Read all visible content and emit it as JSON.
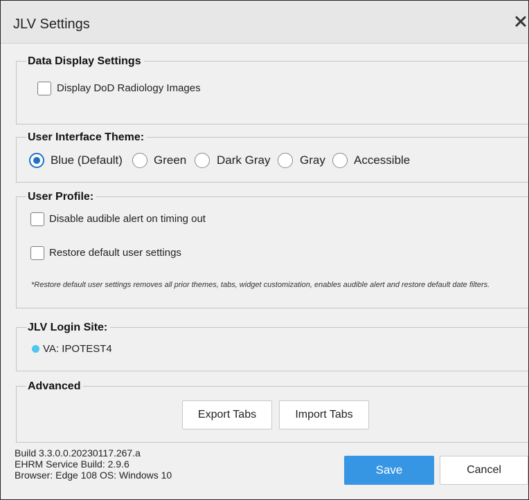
{
  "dialog": {
    "title": "JLV Settings",
    "close_icon": "close-icon"
  },
  "data_display": {
    "legend": "Data Display Settings",
    "radiology_label": "Display DoD Radiology Images",
    "radiology_checked": false
  },
  "theme": {
    "legend": "User Interface Theme:",
    "options": [
      {
        "label": "Blue (Default)",
        "checked": true
      },
      {
        "label": "Green",
        "checked": false
      },
      {
        "label": "Dark Gray",
        "checked": false
      },
      {
        "label": "Gray",
        "checked": false
      },
      {
        "label": "Accessible",
        "checked": false
      }
    ],
    "accent_color": "#1a73c9"
  },
  "user_profile": {
    "legend": "User Profile:",
    "audible_label": "Disable audible alert on timing out",
    "restore_label": "Restore default user settings",
    "note": "*Restore default user settings removes all prior themes, tabs, widget customization, enables audible alert and restore default date filters."
  },
  "login_site": {
    "legend": "JLV Login Site:",
    "site": "VA: IPOTEST4",
    "status_color": "#4ec6f0"
  },
  "advanced": {
    "legend": "Advanced",
    "export_label": "Export Tabs",
    "import_label": "Import Tabs"
  },
  "footer": {
    "build": "Build 3.3.0.0.20230117.267.a",
    "ehrm": "EHRM Service Build: 2.9.6",
    "browser": "Browser: Edge 108 OS: Windows 10",
    "save_label": "Save",
    "cancel_label": "Cancel",
    "save_color": "#3796e4"
  }
}
